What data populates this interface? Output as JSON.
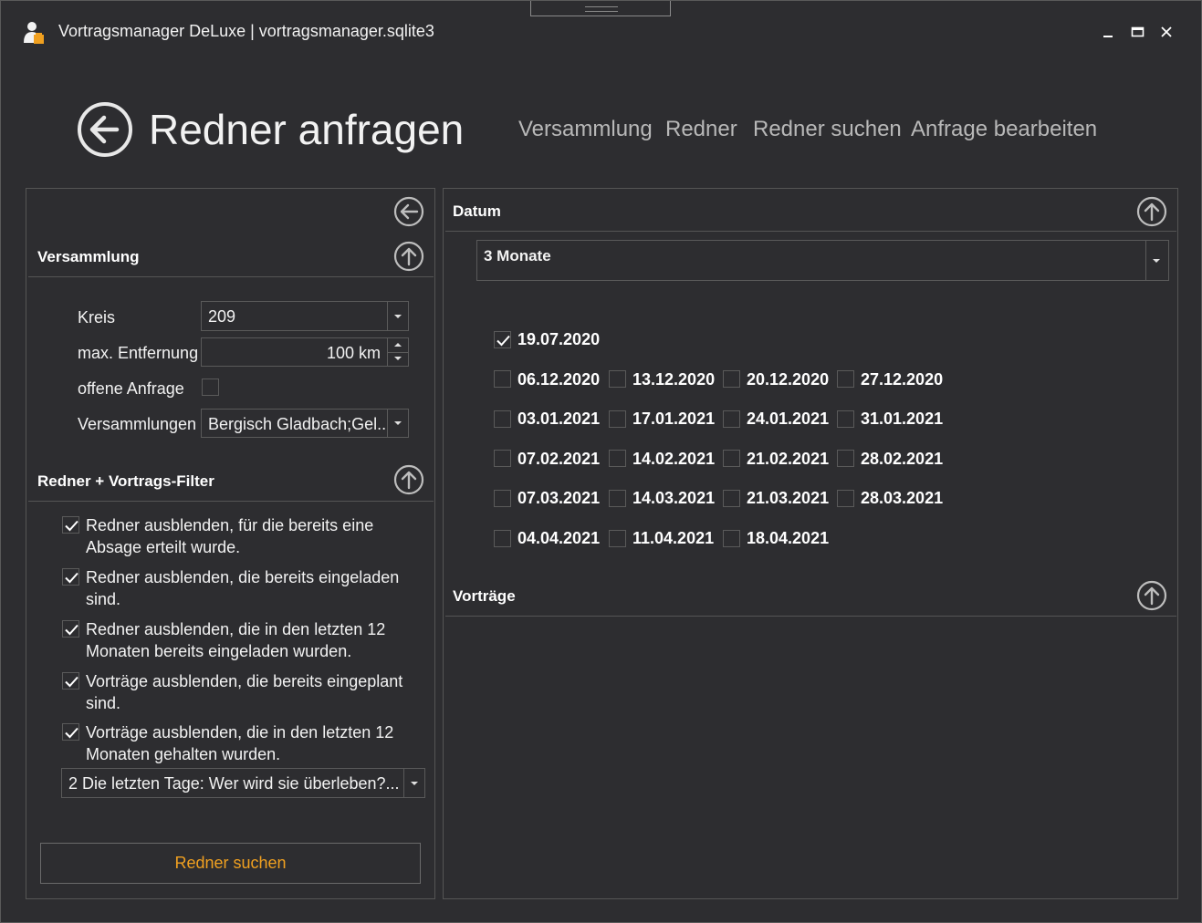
{
  "window": {
    "title": "Vortragsmanager DeLuxe | vortragsmanager.sqlite3",
    "minimize_glyph": "▁",
    "maximize_glyph": "☐",
    "close_glyph": "✕"
  },
  "header": {
    "page_title": "Redner anfragen",
    "nav": [
      "Versammlung",
      "Redner",
      "Redner suchen",
      "Anfrage bearbeiten"
    ]
  },
  "left_panel": {
    "versammlung": {
      "title": "Versammlung",
      "kreis_label": "Kreis",
      "kreis_value": "209",
      "entfernung_label": "max. Entfernung",
      "entfernung_value": "100 km",
      "offene_label": "offene Anfrage",
      "offene_checked": false,
      "versammlungen_label": "Versammlungen",
      "versammlungen_value": "Bergisch Gladbach;Gel..."
    },
    "filter": {
      "title": "Redner + Vortrags-Filter",
      "options": [
        {
          "label": "Redner ausblenden, für die bereits eine Absage erteilt wurde.",
          "checked": true
        },
        {
          "label": "Redner ausblenden, die bereits eingeladen sind.",
          "checked": true
        },
        {
          "label": "Redner ausblenden, die in den letzten 12 Monaten bereits eingeladen wurden.",
          "checked": true
        },
        {
          "label": "Vorträge ausblenden, die bereits eingeplant sind.",
          "checked": true
        },
        {
          "label": "Vorträge ausblenden, die in den letzten 12 Monaten gehalten wurden.",
          "checked": true
        }
      ],
      "vortrag_value": "2 Die letzten Tage: Wer wird sie überleben?..."
    },
    "search_button": "Redner suchen"
  },
  "right_panel": {
    "datum": {
      "title": "Datum",
      "range_value": "3 Monate",
      "dates": [
        [
          {
            "d": "19.07.2020",
            "checked": true
          }
        ],
        [
          {
            "d": "06.12.2020",
            "checked": false
          },
          {
            "d": "13.12.2020",
            "checked": false
          },
          {
            "d": "20.12.2020",
            "checked": false
          },
          {
            "d": "27.12.2020",
            "checked": false
          }
        ],
        [
          {
            "d": "03.01.2021",
            "checked": false
          },
          {
            "d": "17.01.2021",
            "checked": false
          },
          {
            "d": "24.01.2021",
            "checked": false
          },
          {
            "d": "31.01.2021",
            "checked": false
          }
        ],
        [
          {
            "d": "07.02.2021",
            "checked": false
          },
          {
            "d": "14.02.2021",
            "checked": false
          },
          {
            "d": "21.02.2021",
            "checked": false
          },
          {
            "d": "28.02.2021",
            "checked": false
          }
        ],
        [
          {
            "d": "07.03.2021",
            "checked": false
          },
          {
            "d": "14.03.2021",
            "checked": false
          },
          {
            "d": "21.03.2021",
            "checked": false
          },
          {
            "d": "28.03.2021",
            "checked": false
          }
        ],
        [
          {
            "d": "04.04.2021",
            "checked": false
          },
          {
            "d": "11.04.2021",
            "checked": false
          },
          {
            "d": "18.04.2021",
            "checked": false
          }
        ]
      ]
    },
    "vortraege": {
      "title": "Vorträge"
    }
  },
  "colors": {
    "background": "#2d2d30",
    "accent": "#f0a020",
    "border": "#555555",
    "nav_text": "#b8b8b8"
  }
}
